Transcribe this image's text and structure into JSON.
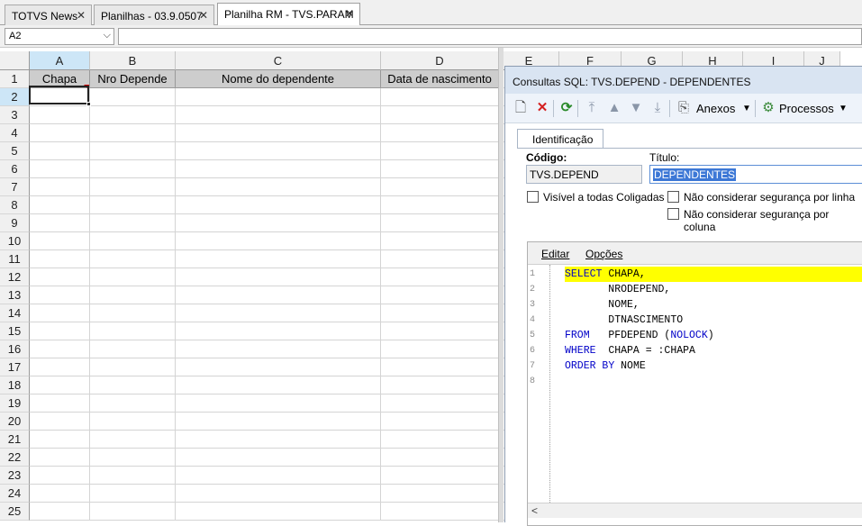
{
  "tabs": [
    {
      "label": "TOTVS News"
    },
    {
      "label": "Planilhas - 03.9.0507"
    },
    {
      "label": "Planilha RM - TVS.PARAM"
    }
  ],
  "namebox": {
    "value": "A2"
  },
  "columns": [
    "A",
    "B",
    "C",
    "D",
    "E",
    "F",
    "G",
    "H",
    "I",
    "J"
  ],
  "header_row": [
    "Chapa",
    "Nro Depende",
    "Nome do dependente",
    "Data de nascimento"
  ],
  "rows": [
    "1",
    "2",
    "3",
    "4",
    "5",
    "6",
    "7",
    "8",
    "9",
    "10",
    "11",
    "12",
    "13",
    "14",
    "15",
    "16",
    "17",
    "18",
    "19",
    "20",
    "21",
    "22",
    "23",
    "24",
    "25"
  ],
  "dialog": {
    "title": "Consultas SQL: TVS.DEPEND - DEPENDENTES",
    "toolbar": {
      "anexos": "Anexos",
      "processos": "Processos"
    },
    "tab": "Identificação",
    "codigo_label": "Código:",
    "codigo_value": "TVS.DEPEND",
    "titulo_label": "Título:",
    "titulo_value": "DEPENDENTES",
    "chk_coligadas": "Visível a todas Coligadas",
    "chk_linha": "Não considerar segurança por linha",
    "chk_coluna": "Não considerar segurança por coluna",
    "menu": {
      "editar": "Editar",
      "opcoes": "Opções"
    },
    "sql_lines": [
      {
        "n": "1",
        "text": "SELECT CHAPA,"
      },
      {
        "n": "2",
        "text": "       NRODEPEND,"
      },
      {
        "n": "3",
        "text": "       NOME,"
      },
      {
        "n": "4",
        "text": "       DTNASCIMENTO"
      },
      {
        "n": "5",
        "text": "FROM   PFDEPEND (NOLOCK)"
      },
      {
        "n": "6",
        "text": "WHERE  CHAPA = :CHAPA"
      },
      {
        "n": "7",
        "text": "ORDER BY NOME"
      },
      {
        "n": "8",
        "text": ""
      }
    ]
  },
  "colors": {
    "keyword": "#0000c8",
    "highlight": "#ffff00",
    "selected_header": "#cde6f7"
  }
}
